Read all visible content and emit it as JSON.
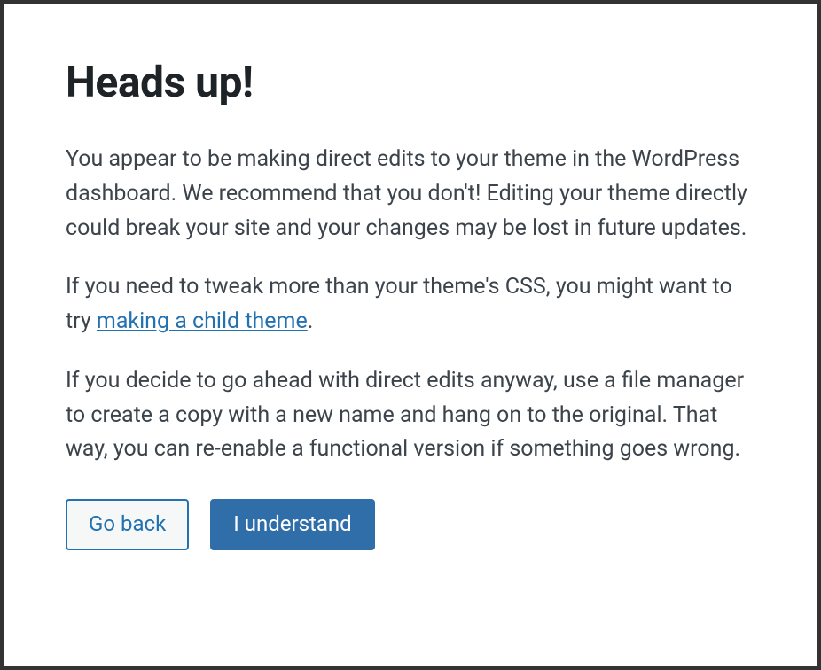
{
  "dialog": {
    "title": "Heads up!",
    "paragraph1": "You appear to be making direct edits to your theme in the WordPress dashboard. We recommend that you don't! Editing your theme directly could break your site and your changes may be lost in future updates.",
    "paragraph2_before": "If you need to tweak more than your theme's CSS, you might want to try ",
    "paragraph2_link": "making a child theme",
    "paragraph2_after": ".",
    "paragraph3": "If you decide to go ahead with direct edits anyway, use a file manager to create a copy with a new name and hang on to the original. That way, you can re-enable a functional version if something goes wrong.",
    "buttons": {
      "go_back": "Go back",
      "understand": "I understand"
    }
  }
}
